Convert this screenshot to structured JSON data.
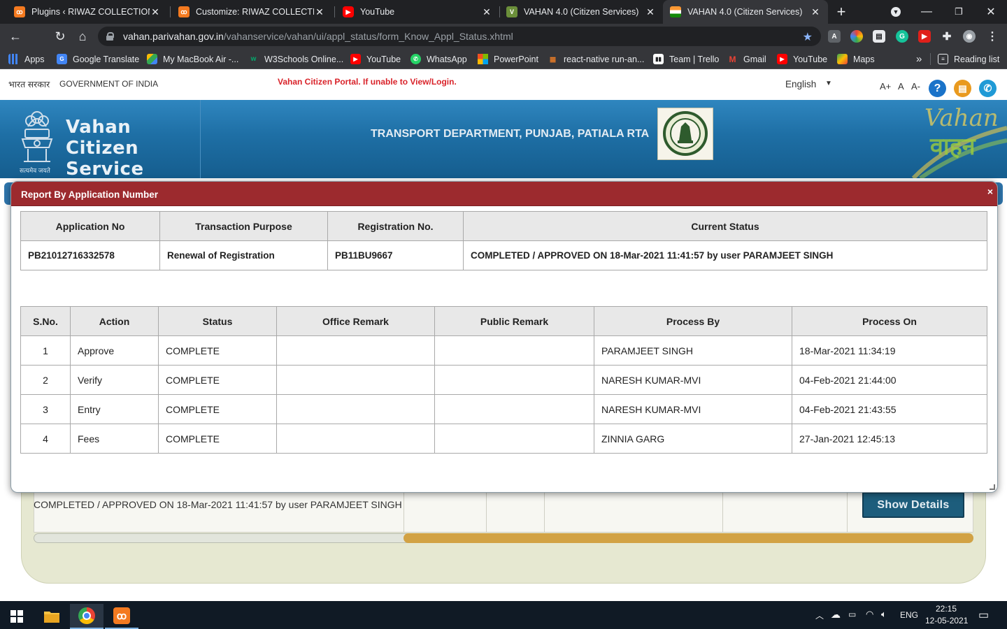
{
  "browser": {
    "tabs": [
      {
        "title": "Plugins ‹ RIWAZ COLLECTION —",
        "icon": "xampp-icon"
      },
      {
        "title": "Customize: RIWAZ COLLECTION",
        "icon": "xampp-icon"
      },
      {
        "title": "YouTube",
        "icon": "youtube-icon"
      },
      {
        "title": "VAHAN 4.0 (Citizen Services)",
        "icon": "vahan-icon"
      },
      {
        "title": "VAHAN 4.0 (Citizen Services)",
        "icon": "india-flag-icon"
      }
    ],
    "url_host": "vahan.parivahan.gov.in",
    "url_path": "/vahanservice/vahan/ui/appl_status/form_Know_Appl_Status.xhtml",
    "bookmarks": [
      {
        "label": "Apps",
        "icon": "apps-grid-icon",
        "color": "#4285f4"
      },
      {
        "label": "Google Translate",
        "icon": "google-translate-icon",
        "color": "#4285f4"
      },
      {
        "label": "My MacBook Air -...",
        "icon": "drive-icon",
        "color": "#0f9d58"
      },
      {
        "label": "W3Schools Online...",
        "icon": "w3schools-icon",
        "color": "#04aa6d"
      },
      {
        "label": "YouTube",
        "icon": "youtube-icon",
        "color": "#ff0000"
      },
      {
        "label": "WhatsApp",
        "icon": "whatsapp-icon",
        "color": "#25d366"
      },
      {
        "label": "PowerPoint",
        "icon": "microsoft-icon",
        "color": "#f25022"
      },
      {
        "label": "react-native run-an...",
        "icon": "stackoverflow-icon",
        "color": "#f48024"
      },
      {
        "label": "Team | Trello",
        "icon": "trello-icon",
        "color": "#ffffff"
      },
      {
        "label": "Gmail",
        "icon": "gmail-icon",
        "color": "#ea4335"
      },
      {
        "label": "YouTube",
        "icon": "youtube-icon",
        "color": "#ff0000"
      },
      {
        "label": "Maps",
        "icon": "maps-icon",
        "color": "#34a853"
      }
    ],
    "bookmarks_overflow": "»",
    "reading_list": "Reading list"
  },
  "site": {
    "hindi_label": "भारत सरकार",
    "gov_label": "GOVERNMENT OF INDIA",
    "notice": "Vahan Citizen Portal. If unable to View/Login.",
    "language": "English",
    "font_increase": "A+",
    "font_normal": "A",
    "font_decrease": "A-",
    "title": "Vahan Citizen Service",
    "motto": "सत्यमेव जयते",
    "department": "TRANSPORT DEPARTMENT, PUNJAB, PATIALA RTA",
    "brand_en": "Vahan",
    "brand_hi": "वाहन"
  },
  "modal": {
    "title": "Report By Application Number",
    "close": "×",
    "application_headers": [
      "Application No",
      "Transaction Purpose",
      "Registration No.",
      "Current Status"
    ],
    "application_row": {
      "application_no": "PB21012716332578",
      "purpose": "Renewal of Registration",
      "registration_no": "PB11BU9667",
      "status": "COMPLETED / APPROVED ON 18-Mar-2021 11:41:57 by user PARAMJEET SINGH"
    },
    "process_headers": [
      "S.No.",
      "Action",
      "Status",
      "Office Remark",
      "Public Remark",
      "Process By",
      "Process On"
    ],
    "process_rows": [
      {
        "sno": "1",
        "action": "Approve",
        "status": "COMPLETE",
        "office_remark": "",
        "public_remark": "",
        "by": "PARAMJEET SINGH",
        "on": "18-Mar-2021 11:34:19"
      },
      {
        "sno": "2",
        "action": "Verify",
        "status": "COMPLETE",
        "office_remark": "",
        "public_remark": "",
        "by": "NARESH KUMAR-MVI",
        "on": "04-Feb-2021 21:44:00"
      },
      {
        "sno": "3",
        "action": "Entry",
        "status": "COMPLETE",
        "office_remark": "",
        "public_remark": "",
        "by": "NARESH KUMAR-MVI",
        "on": "04-Feb-2021 21:43:55"
      },
      {
        "sno": "4",
        "action": "Fees",
        "status": "COMPLETE",
        "office_remark": "",
        "public_remark": "",
        "by": "ZINNIA GARG",
        "on": "27-Jan-2021 12:45:13"
      }
    ]
  },
  "background": {
    "status_text": "COMPLETED / APPROVED ON 18-Mar-2021 11:41:57 by user PARAMJEET SINGH",
    "show_details": "Show Details"
  },
  "taskbar": {
    "language": "ENG",
    "time": "22:15",
    "date": "12-05-2021"
  },
  "colors": {
    "modal_header": "#9c2a2e",
    "banner": "#1e6fa5",
    "show_details": "#1d5d7c",
    "scroll_thumb": "#d2a244"
  }
}
